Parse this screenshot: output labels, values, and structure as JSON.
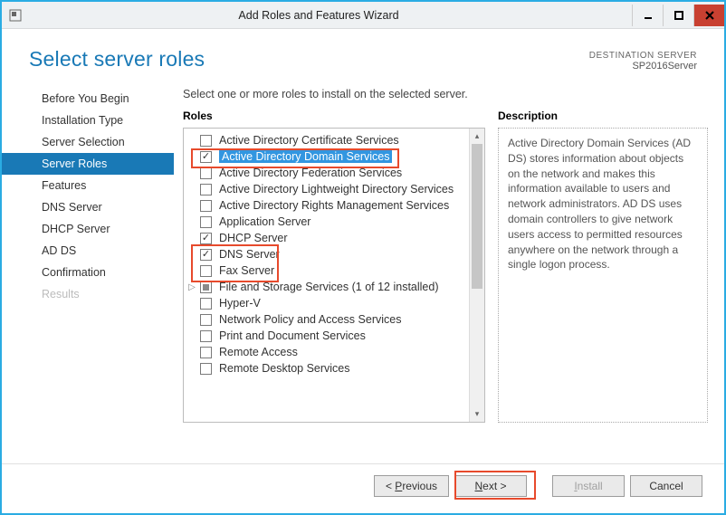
{
  "window": {
    "title": "Add Roles and Features Wizard"
  },
  "heading": "Select server roles",
  "destination": {
    "label": "DESTINATION SERVER",
    "name": "SP2016Server"
  },
  "sidebar": {
    "items": [
      {
        "label": "Before You Begin"
      },
      {
        "label": "Installation Type"
      },
      {
        "label": "Server Selection"
      },
      {
        "label": "Server Roles",
        "active": true
      },
      {
        "label": "Features"
      },
      {
        "label": "DNS Server"
      },
      {
        "label": "DHCP Server"
      },
      {
        "label": "AD DS"
      },
      {
        "label": "Confirmation"
      },
      {
        "label": "Results",
        "disabled": true
      }
    ]
  },
  "instruction": "Select one or more roles to install on the selected server.",
  "roles_heading": "Roles",
  "description_heading": "Description",
  "roles": [
    {
      "label": "Active Directory Certificate Services",
      "checked": false
    },
    {
      "label": "Active Directory Domain Services",
      "checked": true,
      "selected": true
    },
    {
      "label": "Active Directory Federation Services",
      "checked": false
    },
    {
      "label": "Active Directory Lightweight Directory Services",
      "checked": false
    },
    {
      "label": "Active Directory Rights Management Services",
      "checked": false
    },
    {
      "label": "Application Server",
      "checked": false
    },
    {
      "label": "DHCP Server",
      "checked": true
    },
    {
      "label": "DNS Server",
      "checked": true
    },
    {
      "label": "Fax Server",
      "checked": false
    },
    {
      "label": "File and Storage Services (1 of 12 installed)",
      "checked": "partial",
      "expandable": true
    },
    {
      "label": "Hyper-V",
      "checked": false
    },
    {
      "label": "Network Policy and Access Services",
      "checked": false
    },
    {
      "label": "Print and Document Services",
      "checked": false
    },
    {
      "label": "Remote Access",
      "checked": false
    },
    {
      "label": "Remote Desktop Services",
      "checked": false
    }
  ],
  "description_text": "Active Directory Domain Services (AD DS) stores information about objects on the network and makes this information available to users and network administrators. AD DS uses domain controllers to give network users access to permitted resources anywhere on the network through a single logon process.",
  "buttons": {
    "previous": "Previous",
    "next": "Next >",
    "install": "Install",
    "cancel": "Cancel"
  }
}
